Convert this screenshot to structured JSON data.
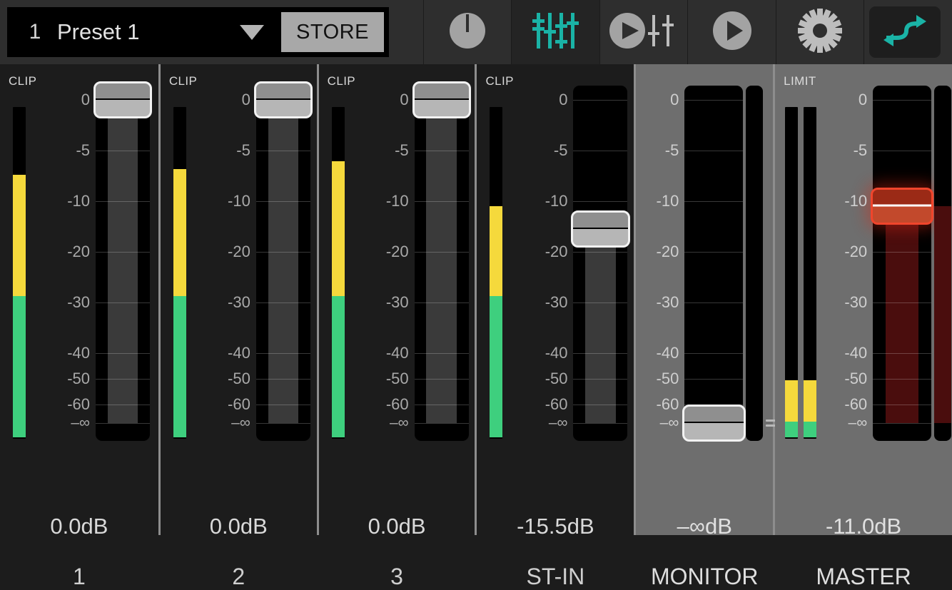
{
  "header": {
    "preset": {
      "number": "1",
      "name": "Preset 1",
      "caret_icon": "chevron-down-icon",
      "store_label": "STORE"
    },
    "toolbar": [
      {
        "name": "knob-icon",
        "label": "",
        "active": false
      },
      {
        "name": "faders-icon",
        "label": "",
        "active": true
      },
      {
        "name": "play-faders-icon",
        "label": "",
        "active": false
      },
      {
        "name": "play-icon",
        "label": "",
        "active": false
      },
      {
        "name": "gear-icon",
        "label": "",
        "active": false
      },
      {
        "name": "routing-icon",
        "label": "",
        "active": false
      }
    ]
  },
  "scale": {
    "ticks": [
      {
        "label": "0",
        "db": 0
      },
      {
        "label": "-5",
        "db": -5
      },
      {
        "label": "-10",
        "db": -10
      },
      {
        "label": "-20",
        "db": -20
      },
      {
        "label": "-30",
        "db": -30
      },
      {
        "label": "-40",
        "db": -40
      },
      {
        "label": "-50",
        "db": -50
      },
      {
        "label": "-60",
        "db": -60
      },
      {
        "label": "–∞",
        "db": -100
      }
    ]
  },
  "channels": [
    {
      "id": "ch1",
      "name": "1",
      "db_value": "0.0dB",
      "fader_db": 0,
      "top_label": "CLIP",
      "theme": "dark",
      "fader_color": "gray",
      "meters": [
        {
          "peak_db": -7.5,
          "green_to_yellow_db": -29
        }
      ],
      "stereo": false
    },
    {
      "id": "ch2",
      "name": "2",
      "db_value": "0.0dB",
      "fader_db": 0,
      "top_label": "CLIP",
      "theme": "dark",
      "fader_color": "gray",
      "meters": [
        {
          "peak_db": -7.0,
          "green_to_yellow_db": -29
        }
      ],
      "stereo": false
    },
    {
      "id": "ch3",
      "name": "3",
      "db_value": "0.0dB",
      "fader_db": 0,
      "top_label": "CLIP",
      "theme": "dark",
      "fader_color": "gray",
      "meters": [
        {
          "peak_db": -6.2,
          "green_to_yellow_db": -29
        }
      ],
      "stereo": false
    },
    {
      "id": "st-in",
      "name": "ST-IN",
      "db_value": "-15.5dB",
      "fader_db": -15.5,
      "top_label": "CLIP",
      "theme": "dark",
      "fader_color": "gray",
      "meters": [
        {
          "peak_db": -11.2,
          "green_to_yellow_db": -29
        }
      ],
      "stereo": false
    },
    {
      "id": "monitor",
      "name": "MONITOR",
      "db_value": "–∞dB",
      "fader_db": -100,
      "top_label": "",
      "theme": "gray",
      "fader_color": "gray",
      "meters": [],
      "stereo": false
    },
    {
      "id": "master",
      "name": "MASTER",
      "db_value": "-11.0dB",
      "fader_db": -11.0,
      "top_label": "LIMIT",
      "theme": "gray",
      "fader_color": "red",
      "meters": [
        {
          "peak_db": -51,
          "green_to_yellow_db": -100
        },
        {
          "peak_db": -51,
          "green_to_yellow_db": -100
        }
      ],
      "stereo": true
    }
  ]
}
